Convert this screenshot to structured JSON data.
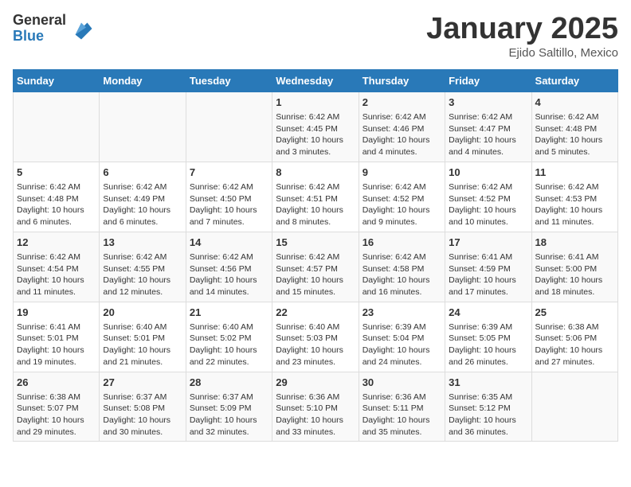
{
  "logo": {
    "general": "General",
    "blue": "Blue"
  },
  "header": {
    "title": "January 2025",
    "subtitle": "Ejido Saltillo, Mexico"
  },
  "weekdays": [
    "Sunday",
    "Monday",
    "Tuesday",
    "Wednesday",
    "Thursday",
    "Friday",
    "Saturday"
  ],
  "weeks": [
    [
      {
        "day": "",
        "info": ""
      },
      {
        "day": "",
        "info": ""
      },
      {
        "day": "",
        "info": ""
      },
      {
        "day": "1",
        "info": "Sunrise: 6:42 AM\nSunset: 4:45 PM\nDaylight: 10 hours\nand 3 minutes."
      },
      {
        "day": "2",
        "info": "Sunrise: 6:42 AM\nSunset: 4:46 PM\nDaylight: 10 hours\nand 4 minutes."
      },
      {
        "day": "3",
        "info": "Sunrise: 6:42 AM\nSunset: 4:47 PM\nDaylight: 10 hours\nand 4 minutes."
      },
      {
        "day": "4",
        "info": "Sunrise: 6:42 AM\nSunset: 4:48 PM\nDaylight: 10 hours\nand 5 minutes."
      }
    ],
    [
      {
        "day": "5",
        "info": "Sunrise: 6:42 AM\nSunset: 4:48 PM\nDaylight: 10 hours\nand 6 minutes."
      },
      {
        "day": "6",
        "info": "Sunrise: 6:42 AM\nSunset: 4:49 PM\nDaylight: 10 hours\nand 6 minutes."
      },
      {
        "day": "7",
        "info": "Sunrise: 6:42 AM\nSunset: 4:50 PM\nDaylight: 10 hours\nand 7 minutes."
      },
      {
        "day": "8",
        "info": "Sunrise: 6:42 AM\nSunset: 4:51 PM\nDaylight: 10 hours\nand 8 minutes."
      },
      {
        "day": "9",
        "info": "Sunrise: 6:42 AM\nSunset: 4:52 PM\nDaylight: 10 hours\nand 9 minutes."
      },
      {
        "day": "10",
        "info": "Sunrise: 6:42 AM\nSunset: 4:52 PM\nDaylight: 10 hours\nand 10 minutes."
      },
      {
        "day": "11",
        "info": "Sunrise: 6:42 AM\nSunset: 4:53 PM\nDaylight: 10 hours\nand 11 minutes."
      }
    ],
    [
      {
        "day": "12",
        "info": "Sunrise: 6:42 AM\nSunset: 4:54 PM\nDaylight: 10 hours\nand 11 minutes."
      },
      {
        "day": "13",
        "info": "Sunrise: 6:42 AM\nSunset: 4:55 PM\nDaylight: 10 hours\nand 12 minutes."
      },
      {
        "day": "14",
        "info": "Sunrise: 6:42 AM\nSunset: 4:56 PM\nDaylight: 10 hours\nand 14 minutes."
      },
      {
        "day": "15",
        "info": "Sunrise: 6:42 AM\nSunset: 4:57 PM\nDaylight: 10 hours\nand 15 minutes."
      },
      {
        "day": "16",
        "info": "Sunrise: 6:42 AM\nSunset: 4:58 PM\nDaylight: 10 hours\nand 16 minutes."
      },
      {
        "day": "17",
        "info": "Sunrise: 6:41 AM\nSunset: 4:59 PM\nDaylight: 10 hours\nand 17 minutes."
      },
      {
        "day": "18",
        "info": "Sunrise: 6:41 AM\nSunset: 5:00 PM\nDaylight: 10 hours\nand 18 minutes."
      }
    ],
    [
      {
        "day": "19",
        "info": "Sunrise: 6:41 AM\nSunset: 5:01 PM\nDaylight: 10 hours\nand 19 minutes."
      },
      {
        "day": "20",
        "info": "Sunrise: 6:40 AM\nSunset: 5:01 PM\nDaylight: 10 hours\nand 21 minutes."
      },
      {
        "day": "21",
        "info": "Sunrise: 6:40 AM\nSunset: 5:02 PM\nDaylight: 10 hours\nand 22 minutes."
      },
      {
        "day": "22",
        "info": "Sunrise: 6:40 AM\nSunset: 5:03 PM\nDaylight: 10 hours\nand 23 minutes."
      },
      {
        "day": "23",
        "info": "Sunrise: 6:39 AM\nSunset: 5:04 PM\nDaylight: 10 hours\nand 24 minutes."
      },
      {
        "day": "24",
        "info": "Sunrise: 6:39 AM\nSunset: 5:05 PM\nDaylight: 10 hours\nand 26 minutes."
      },
      {
        "day": "25",
        "info": "Sunrise: 6:38 AM\nSunset: 5:06 PM\nDaylight: 10 hours\nand 27 minutes."
      }
    ],
    [
      {
        "day": "26",
        "info": "Sunrise: 6:38 AM\nSunset: 5:07 PM\nDaylight: 10 hours\nand 29 minutes."
      },
      {
        "day": "27",
        "info": "Sunrise: 6:37 AM\nSunset: 5:08 PM\nDaylight: 10 hours\nand 30 minutes."
      },
      {
        "day": "28",
        "info": "Sunrise: 6:37 AM\nSunset: 5:09 PM\nDaylight: 10 hours\nand 32 minutes."
      },
      {
        "day": "29",
        "info": "Sunrise: 6:36 AM\nSunset: 5:10 PM\nDaylight: 10 hours\nand 33 minutes."
      },
      {
        "day": "30",
        "info": "Sunrise: 6:36 AM\nSunset: 5:11 PM\nDaylight: 10 hours\nand 35 minutes."
      },
      {
        "day": "31",
        "info": "Sunrise: 6:35 AM\nSunset: 5:12 PM\nDaylight: 10 hours\nand 36 minutes."
      },
      {
        "day": "",
        "info": ""
      }
    ]
  ]
}
